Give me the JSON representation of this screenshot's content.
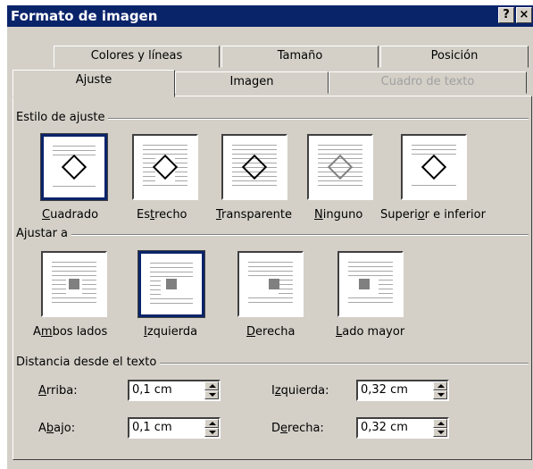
{
  "window": {
    "title": "Formato de imagen",
    "help_glyph": "?",
    "close_glyph": "×"
  },
  "tabs_row1": [
    {
      "label": "Colores y líneas"
    },
    {
      "label": "Tamaño"
    },
    {
      "label": "Posición"
    }
  ],
  "tabs_row2": [
    {
      "label": "Ajuste",
      "state": "active"
    },
    {
      "label": "Imagen",
      "state": "normal"
    },
    {
      "label": "Cuadro de texto",
      "state": "disabled"
    }
  ],
  "estilo": {
    "group_label": "Estilo de ajuste",
    "options": [
      {
        "pre": "",
        "u": "C",
        "post": "uadrado",
        "icon": "wrap-square-icon",
        "selected": true
      },
      {
        "pre": "Es",
        "u": "t",
        "post": "recho",
        "icon": "wrap-tight-icon",
        "selected": false
      },
      {
        "pre": "",
        "u": "T",
        "post": "ransparente",
        "icon": "wrap-through-icon",
        "selected": false
      },
      {
        "pre": "",
        "u": "N",
        "post": "inguno",
        "icon": "wrap-none-icon",
        "selected": false
      },
      {
        "pre": "Superi",
        "u": "o",
        "post": "r e inferior",
        "icon": "wrap-top-bottom-icon",
        "selected": false
      }
    ]
  },
  "ajustar": {
    "group_label": "Ajustar a",
    "options": [
      {
        "pre": "A",
        "u": "m",
        "post": "bos lados",
        "icon": "wrap-both-sides-icon",
        "selected": false
      },
      {
        "pre": "",
        "u": "I",
        "post": "zquierda",
        "icon": "wrap-left-icon",
        "selected": true
      },
      {
        "pre": "",
        "u": "D",
        "post": "erecha",
        "icon": "wrap-right-icon",
        "selected": false
      },
      {
        "pre": "",
        "u": "L",
        "post": "ado mayor",
        "icon": "wrap-largest-side-icon",
        "selected": false
      }
    ]
  },
  "distancia": {
    "group_label": "Distancia desde el texto",
    "arriba": {
      "pre": "",
      "u": "A",
      "post": "rriba:",
      "value": "0,1 cm"
    },
    "abajo": {
      "pre": "A",
      "u": "b",
      "post": "ajo:",
      "value": "0,1 cm"
    },
    "izquierda": {
      "pre": "I",
      "u": "z",
      "post": "quierda:",
      "value": "0,32 cm"
    },
    "derecha": {
      "pre": "D",
      "u": "e",
      "post": "recha:",
      "value": "0,32 cm"
    }
  },
  "colors": {
    "title_bar": "#0a246a",
    "face": "#d4d0c8",
    "selection": "#0a246a"
  }
}
